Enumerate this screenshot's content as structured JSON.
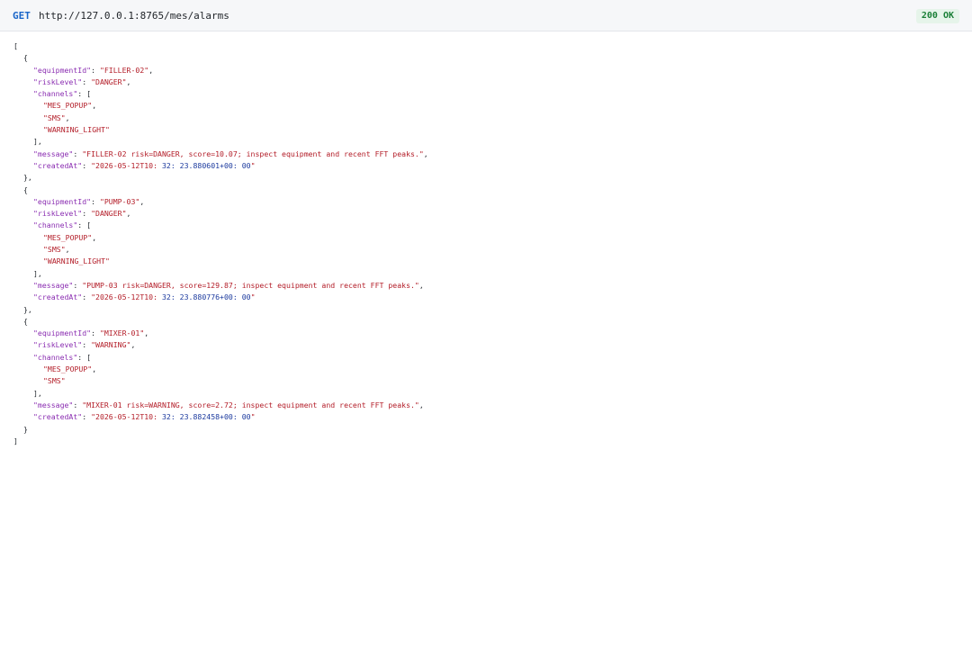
{
  "request": {
    "method": "GET",
    "url": "http://127.0.0.1:8765/mes/alarms",
    "status": "200 OK"
  },
  "alarms": [
    {
      "equipmentId": "FILLER-02",
      "riskLevel": "DANGER",
      "channels": [
        "MES_POPUP",
        "SMS",
        "WARNING_LIGHT"
      ],
      "message": "FILLER-02 risk=DANGER, score=10.07; inspect equipment and recent FFT peaks.",
      "createdAt": "2026-05-12T10: 32: 23.880601+00: 00"
    },
    {
      "equipmentId": "PUMP-03",
      "riskLevel": "DANGER",
      "channels": [
        "MES_POPUP",
        "SMS",
        "WARNING_LIGHT"
      ],
      "message": "PUMP-03 risk=DANGER, score=129.87; inspect equipment and recent FFT peaks.",
      "createdAt": "2026-05-12T10: 32: 23.880776+00: 00"
    },
    {
      "equipmentId": "MIXER-01",
      "riskLevel": "WARNING",
      "channels": [
        "MES_POPUP",
        "SMS"
      ],
      "message": "MIXER-01 risk=WARNING, score=2.72; inspect equipment and recent FFT peaks.",
      "createdAt": "2026-05-12T10: 32: 23.882458+00: 00"
    }
  ]
}
